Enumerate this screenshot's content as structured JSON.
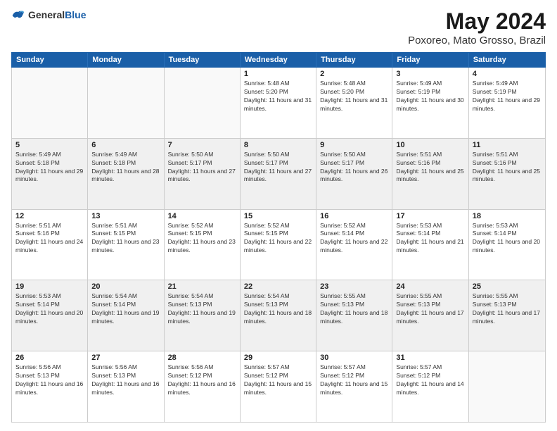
{
  "logo": {
    "general": "General",
    "blue": "Blue"
  },
  "title": "May 2024",
  "subtitle": "Poxoreo, Mato Grosso, Brazil",
  "days_of_week": [
    "Sunday",
    "Monday",
    "Tuesday",
    "Wednesday",
    "Thursday",
    "Friday",
    "Saturday"
  ],
  "weeks": [
    [
      {
        "day": "",
        "empty": true
      },
      {
        "day": "",
        "empty": true
      },
      {
        "day": "",
        "empty": true
      },
      {
        "day": "1",
        "sunrise": "5:48 AM",
        "sunset": "5:20 PM",
        "daylight": "11 hours and 31 minutes."
      },
      {
        "day": "2",
        "sunrise": "5:48 AM",
        "sunset": "5:20 PM",
        "daylight": "11 hours and 31 minutes."
      },
      {
        "day": "3",
        "sunrise": "5:49 AM",
        "sunset": "5:19 PM",
        "daylight": "11 hours and 30 minutes."
      },
      {
        "day": "4",
        "sunrise": "5:49 AM",
        "sunset": "5:19 PM",
        "daylight": "11 hours and 29 minutes."
      }
    ],
    [
      {
        "day": "5",
        "sunrise": "5:49 AM",
        "sunset": "5:18 PM",
        "daylight": "11 hours and 29 minutes."
      },
      {
        "day": "6",
        "sunrise": "5:49 AM",
        "sunset": "5:18 PM",
        "daylight": "11 hours and 28 minutes."
      },
      {
        "day": "7",
        "sunrise": "5:50 AM",
        "sunset": "5:17 PM",
        "daylight": "11 hours and 27 minutes."
      },
      {
        "day": "8",
        "sunrise": "5:50 AM",
        "sunset": "5:17 PM",
        "daylight": "11 hours and 27 minutes."
      },
      {
        "day": "9",
        "sunrise": "5:50 AM",
        "sunset": "5:17 PM",
        "daylight": "11 hours and 26 minutes."
      },
      {
        "day": "10",
        "sunrise": "5:51 AM",
        "sunset": "5:16 PM",
        "daylight": "11 hours and 25 minutes."
      },
      {
        "day": "11",
        "sunrise": "5:51 AM",
        "sunset": "5:16 PM",
        "daylight": "11 hours and 25 minutes."
      }
    ],
    [
      {
        "day": "12",
        "sunrise": "5:51 AM",
        "sunset": "5:16 PM",
        "daylight": "11 hours and 24 minutes."
      },
      {
        "day": "13",
        "sunrise": "5:51 AM",
        "sunset": "5:15 PM",
        "daylight": "11 hours and 23 minutes."
      },
      {
        "day": "14",
        "sunrise": "5:52 AM",
        "sunset": "5:15 PM",
        "daylight": "11 hours and 23 minutes."
      },
      {
        "day": "15",
        "sunrise": "5:52 AM",
        "sunset": "5:15 PM",
        "daylight": "11 hours and 22 minutes."
      },
      {
        "day": "16",
        "sunrise": "5:52 AM",
        "sunset": "5:14 PM",
        "daylight": "11 hours and 22 minutes."
      },
      {
        "day": "17",
        "sunrise": "5:53 AM",
        "sunset": "5:14 PM",
        "daylight": "11 hours and 21 minutes."
      },
      {
        "day": "18",
        "sunrise": "5:53 AM",
        "sunset": "5:14 PM",
        "daylight": "11 hours and 20 minutes."
      }
    ],
    [
      {
        "day": "19",
        "sunrise": "5:53 AM",
        "sunset": "5:14 PM",
        "daylight": "11 hours and 20 minutes."
      },
      {
        "day": "20",
        "sunrise": "5:54 AM",
        "sunset": "5:14 PM",
        "daylight": "11 hours and 19 minutes."
      },
      {
        "day": "21",
        "sunrise": "5:54 AM",
        "sunset": "5:13 PM",
        "daylight": "11 hours and 19 minutes."
      },
      {
        "day": "22",
        "sunrise": "5:54 AM",
        "sunset": "5:13 PM",
        "daylight": "11 hours and 18 minutes."
      },
      {
        "day": "23",
        "sunrise": "5:55 AM",
        "sunset": "5:13 PM",
        "daylight": "11 hours and 18 minutes."
      },
      {
        "day": "24",
        "sunrise": "5:55 AM",
        "sunset": "5:13 PM",
        "daylight": "11 hours and 17 minutes."
      },
      {
        "day": "25",
        "sunrise": "5:55 AM",
        "sunset": "5:13 PM",
        "daylight": "11 hours and 17 minutes."
      }
    ],
    [
      {
        "day": "26",
        "sunrise": "5:56 AM",
        "sunset": "5:13 PM",
        "daylight": "11 hours and 16 minutes."
      },
      {
        "day": "27",
        "sunrise": "5:56 AM",
        "sunset": "5:13 PM",
        "daylight": "11 hours and 16 minutes."
      },
      {
        "day": "28",
        "sunrise": "5:56 AM",
        "sunset": "5:12 PM",
        "daylight": "11 hours and 16 minutes."
      },
      {
        "day": "29",
        "sunrise": "5:57 AM",
        "sunset": "5:12 PM",
        "daylight": "11 hours and 15 minutes."
      },
      {
        "day": "30",
        "sunrise": "5:57 AM",
        "sunset": "5:12 PM",
        "daylight": "11 hours and 15 minutes."
      },
      {
        "day": "31",
        "sunrise": "5:57 AM",
        "sunset": "5:12 PM",
        "daylight": "11 hours and 14 minutes."
      },
      {
        "day": "",
        "empty": true
      }
    ]
  ]
}
